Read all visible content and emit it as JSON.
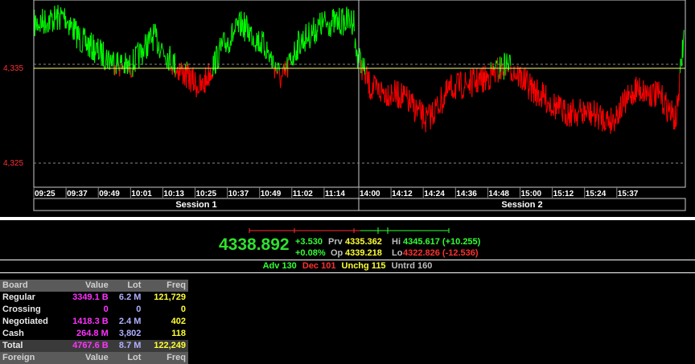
{
  "colors": {
    "up": "#00ff00",
    "down": "#ff0000",
    "prev_line": "#ffff66",
    "grid": "#888888"
  },
  "chart": {
    "y_ticks": [
      "4,335",
      "4,325"
    ],
    "x_ticks_s1": [
      "09:25",
      "09:37",
      "09:49",
      "10:01",
      "10:13",
      "10:25",
      "10:37",
      "10:49",
      "11:02",
      "11:14"
    ],
    "x_ticks_s2": [
      "14:00",
      "14:12",
      "14:24",
      "14:36",
      "14:48",
      "15:00",
      "15:12",
      "15:24",
      "15:37"
    ],
    "session1_label": "Session 1",
    "session2_label": "Session 2",
    "previous_close": 4335.362
  },
  "index": {
    "last": "4338.892",
    "change": "+3.530",
    "change_pct": "+0.08%",
    "prev_label": "Prv",
    "prev": "4335.362",
    "open_label": "Op",
    "open": "4339.218",
    "hi_label": "Hi",
    "hi": "4345.617 (+10.255)",
    "lo_label": "Lo",
    "lo": "4322.826 (-12.536)"
  },
  "breadth": {
    "adv": "Adv 130",
    "dec": "Dec 101",
    "unchg": "Unchg 115",
    "untrd": "Untrd 160"
  },
  "board": {
    "headers": [
      "Board",
      "Value",
      "Lot",
      "Freq"
    ],
    "rows": [
      {
        "name": "Regular",
        "value": "3349.1 B",
        "lot": "6.2 M",
        "freq": "121,729"
      },
      {
        "name": "Crossing",
        "value": "0",
        "lot": "0",
        "freq": "0"
      },
      {
        "name": "Negotiated",
        "value": "1418.3 B",
        "lot": "2.4 M",
        "freq": "402"
      },
      {
        "name": "Cash",
        "value": "264.8 M",
        "lot": "3,802",
        "freq": "118"
      }
    ],
    "total": {
      "name": "Total",
      "value": "4767.6 B",
      "lot": "8.7 M",
      "freq": "122,249"
    },
    "foreign_headers": [
      "Foreign",
      "Value",
      "Lot",
      "Freq"
    ]
  }
}
